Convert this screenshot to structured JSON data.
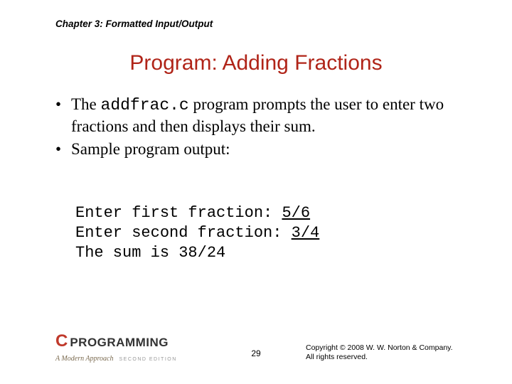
{
  "chapter": "Chapter 3: Formatted Input/Output",
  "title": "Program: Adding Fractions",
  "bullets": [
    {
      "pre": "The ",
      "code": "addfrac.c",
      "post": " program prompts the user to enter two fractions and then displays their sum."
    },
    {
      "pre": "Sample program output:",
      "code": "",
      "post": ""
    }
  ],
  "output": {
    "lines": [
      {
        "prompt": "Enter first fraction: ",
        "user": "5/6"
      },
      {
        "prompt": "Enter second fraction: ",
        "user": "3/4"
      },
      {
        "prompt": "The sum is 38/24",
        "user": ""
      }
    ]
  },
  "logo": {
    "c": "C",
    "prog": "PROGRAMMING",
    "sub": "A Modern Approach",
    "ed": "SECOND EDITION"
  },
  "pagenum": "29",
  "copyright_l1": "Copyright © 2008 W. W. Norton & Company.",
  "copyright_l2": "All rights reserved."
}
